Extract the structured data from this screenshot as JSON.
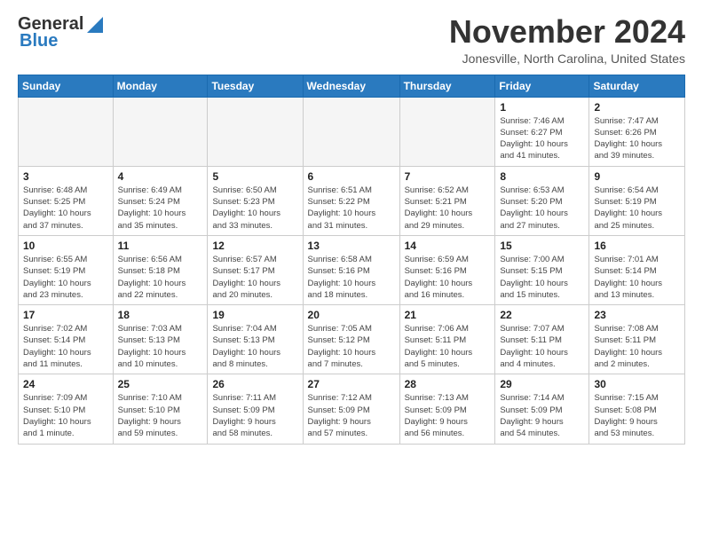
{
  "header": {
    "logo_general": "General",
    "logo_blue": "Blue",
    "month": "November 2024",
    "location": "Jonesville, North Carolina, United States"
  },
  "weekdays": [
    "Sunday",
    "Monday",
    "Tuesday",
    "Wednesday",
    "Thursday",
    "Friday",
    "Saturday"
  ],
  "weeks": [
    [
      {
        "day": "",
        "info": ""
      },
      {
        "day": "",
        "info": ""
      },
      {
        "day": "",
        "info": ""
      },
      {
        "day": "",
        "info": ""
      },
      {
        "day": "",
        "info": ""
      },
      {
        "day": "1",
        "info": "Sunrise: 7:46 AM\nSunset: 6:27 PM\nDaylight: 10 hours\nand 41 minutes."
      },
      {
        "day": "2",
        "info": "Sunrise: 7:47 AM\nSunset: 6:26 PM\nDaylight: 10 hours\nand 39 minutes."
      }
    ],
    [
      {
        "day": "3",
        "info": "Sunrise: 6:48 AM\nSunset: 5:25 PM\nDaylight: 10 hours\nand 37 minutes."
      },
      {
        "day": "4",
        "info": "Sunrise: 6:49 AM\nSunset: 5:24 PM\nDaylight: 10 hours\nand 35 minutes."
      },
      {
        "day": "5",
        "info": "Sunrise: 6:50 AM\nSunset: 5:23 PM\nDaylight: 10 hours\nand 33 minutes."
      },
      {
        "day": "6",
        "info": "Sunrise: 6:51 AM\nSunset: 5:22 PM\nDaylight: 10 hours\nand 31 minutes."
      },
      {
        "day": "7",
        "info": "Sunrise: 6:52 AM\nSunset: 5:21 PM\nDaylight: 10 hours\nand 29 minutes."
      },
      {
        "day": "8",
        "info": "Sunrise: 6:53 AM\nSunset: 5:20 PM\nDaylight: 10 hours\nand 27 minutes."
      },
      {
        "day": "9",
        "info": "Sunrise: 6:54 AM\nSunset: 5:19 PM\nDaylight: 10 hours\nand 25 minutes."
      }
    ],
    [
      {
        "day": "10",
        "info": "Sunrise: 6:55 AM\nSunset: 5:19 PM\nDaylight: 10 hours\nand 23 minutes."
      },
      {
        "day": "11",
        "info": "Sunrise: 6:56 AM\nSunset: 5:18 PM\nDaylight: 10 hours\nand 22 minutes."
      },
      {
        "day": "12",
        "info": "Sunrise: 6:57 AM\nSunset: 5:17 PM\nDaylight: 10 hours\nand 20 minutes."
      },
      {
        "day": "13",
        "info": "Sunrise: 6:58 AM\nSunset: 5:16 PM\nDaylight: 10 hours\nand 18 minutes."
      },
      {
        "day": "14",
        "info": "Sunrise: 6:59 AM\nSunset: 5:16 PM\nDaylight: 10 hours\nand 16 minutes."
      },
      {
        "day": "15",
        "info": "Sunrise: 7:00 AM\nSunset: 5:15 PM\nDaylight: 10 hours\nand 15 minutes."
      },
      {
        "day": "16",
        "info": "Sunrise: 7:01 AM\nSunset: 5:14 PM\nDaylight: 10 hours\nand 13 minutes."
      }
    ],
    [
      {
        "day": "17",
        "info": "Sunrise: 7:02 AM\nSunset: 5:14 PM\nDaylight: 10 hours\nand 11 minutes."
      },
      {
        "day": "18",
        "info": "Sunrise: 7:03 AM\nSunset: 5:13 PM\nDaylight: 10 hours\nand 10 minutes."
      },
      {
        "day": "19",
        "info": "Sunrise: 7:04 AM\nSunset: 5:13 PM\nDaylight: 10 hours\nand 8 minutes."
      },
      {
        "day": "20",
        "info": "Sunrise: 7:05 AM\nSunset: 5:12 PM\nDaylight: 10 hours\nand 7 minutes."
      },
      {
        "day": "21",
        "info": "Sunrise: 7:06 AM\nSunset: 5:11 PM\nDaylight: 10 hours\nand 5 minutes."
      },
      {
        "day": "22",
        "info": "Sunrise: 7:07 AM\nSunset: 5:11 PM\nDaylight: 10 hours\nand 4 minutes."
      },
      {
        "day": "23",
        "info": "Sunrise: 7:08 AM\nSunset: 5:11 PM\nDaylight: 10 hours\nand 2 minutes."
      }
    ],
    [
      {
        "day": "24",
        "info": "Sunrise: 7:09 AM\nSunset: 5:10 PM\nDaylight: 10 hours\nand 1 minute."
      },
      {
        "day": "25",
        "info": "Sunrise: 7:10 AM\nSunset: 5:10 PM\nDaylight: 9 hours\nand 59 minutes."
      },
      {
        "day": "26",
        "info": "Sunrise: 7:11 AM\nSunset: 5:09 PM\nDaylight: 9 hours\nand 58 minutes."
      },
      {
        "day": "27",
        "info": "Sunrise: 7:12 AM\nSunset: 5:09 PM\nDaylight: 9 hours\nand 57 minutes."
      },
      {
        "day": "28",
        "info": "Sunrise: 7:13 AM\nSunset: 5:09 PM\nDaylight: 9 hours\nand 56 minutes."
      },
      {
        "day": "29",
        "info": "Sunrise: 7:14 AM\nSunset: 5:09 PM\nDaylight: 9 hours\nand 54 minutes."
      },
      {
        "day": "30",
        "info": "Sunrise: 7:15 AM\nSunset: 5:08 PM\nDaylight: 9 hours\nand 53 minutes."
      }
    ]
  ]
}
